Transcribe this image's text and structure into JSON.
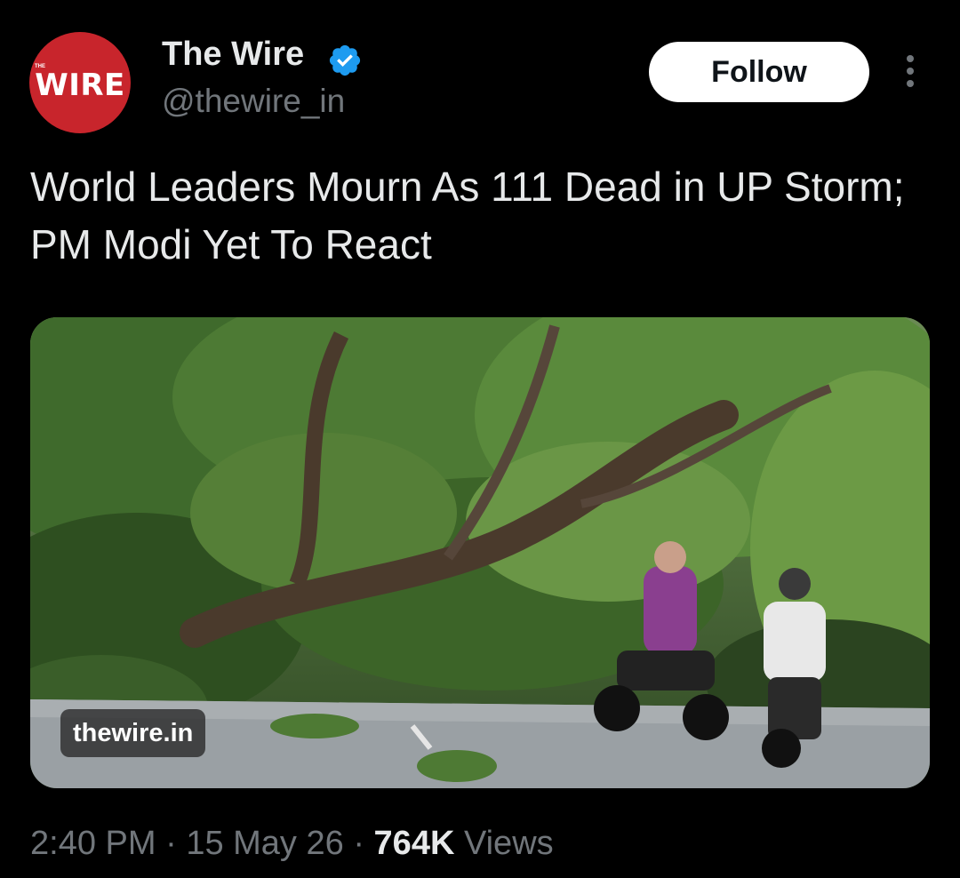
{
  "account": {
    "avatar_small_text": "THE",
    "avatar_text": "WIRE",
    "name": "The Wire",
    "handle": "@thewire_in",
    "verified": true
  },
  "follow_label": "Follow",
  "more_icon": "more-vertical-icon",
  "tweet": {
    "text": "World Leaders Mourn As 111 Dead in UP Storm; PM Modi Yet To React"
  },
  "media": {
    "link_chip": "thewire.in"
  },
  "meta": {
    "time": "2:40 PM",
    "sep1": "·",
    "date": "15 May 26",
    "sep2": "·",
    "views_count": "764K",
    "views_label": "Views"
  },
  "colors": {
    "background": "#000000",
    "text": "#e7e9ea",
    "muted": "#71767b",
    "brand_red": "#c8252c",
    "verified_blue": "#1d9bf0"
  }
}
